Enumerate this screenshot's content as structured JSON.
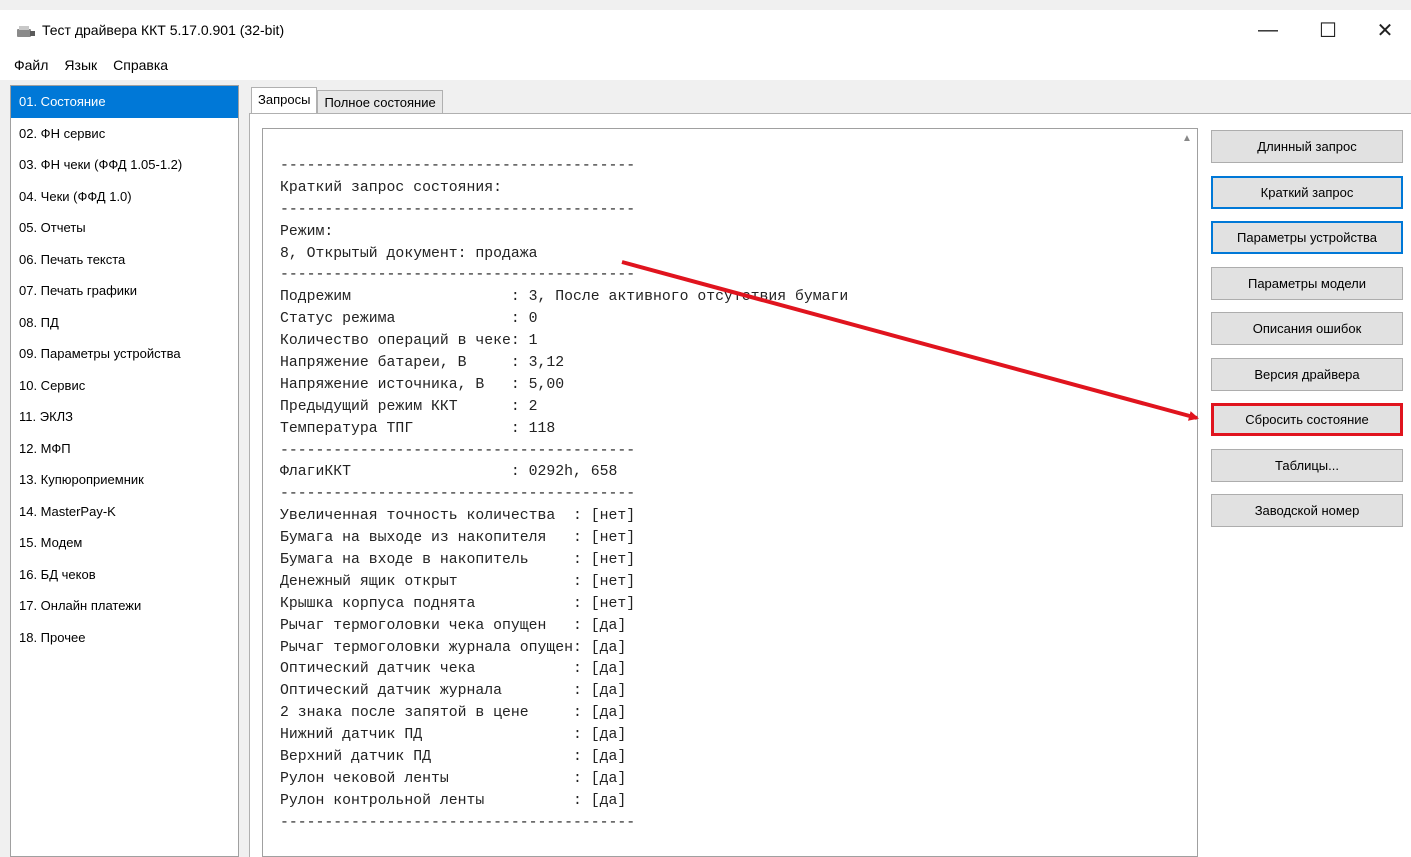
{
  "window": {
    "title": "Тест драйвера ККТ 5.17.0.901 (32-bit)",
    "min_glyph": "—",
    "max_glyph": "☐",
    "close_glyph": "✕"
  },
  "menu": {
    "items": [
      "Файл",
      "Язык",
      "Справка"
    ]
  },
  "sidebar": {
    "selected_index": 0,
    "items": [
      "01. Состояние",
      "02. ФН сервис",
      "03. ФН чеки (ФФД 1.05-1.2)",
      "04. Чеки (ФФД 1.0)",
      "05. Отчеты",
      "06. Печать текста",
      "07. Печать графики",
      "08. ПД",
      "09. Параметры устройства",
      "10. Сервис",
      "11. ЭКЛЗ",
      "12. МФП",
      "13. Купюроприемник",
      "14. MasterPay-K",
      "15. Модем",
      "16. БД чеков",
      "17. Онлайн платежи",
      "18. Прочее"
    ]
  },
  "tabs": {
    "items": [
      "Запросы",
      "Полное состояние"
    ],
    "active_index": 0
  },
  "output": {
    "lines": [
      "----------------------------------------",
      "Краткий запрос состояния:",
      "----------------------------------------",
      "Режим:",
      "8, Открытый документ: продажа",
      "----------------------------------------",
      "Подрежим                  : 3, После активного отсутствия бумаги",
      "Статус режима             : 0",
      "Количество операций в чеке: 1",
      "Напряжение батареи, В     : 3,12",
      "Напряжение источника, В   : 5,00",
      "Предыдущий режим ККТ      : 2",
      "Температура ТПГ           : 118",
      "----------------------------------------",
      "ФлагиККТ                  : 0292h, 658",
      "----------------------------------------",
      "Увеличенная точность количества  : [нет]",
      "Бумага на выходе из накопителя   : [нет]",
      "Бумага на входе в накопитель     : [нет]",
      "Денежный ящик открыт             : [нет]",
      "Крышка корпуса поднята           : [нет]",
      "Рычаг термоголовки чека опущен   : [да]",
      "Рычаг термоголовки журнала опущен: [да]",
      "Оптический датчик чека           : [да]",
      "Оптический датчик журнала        : [да]",
      "2 знака после запятой в цене     : [да]",
      "Нижний датчик ПД                 : [да]",
      "Верхний датчик ПД                : [да]",
      "Рулон чековой ленты              : [да]",
      "Рулон контрольной ленты          : [да]",
      "----------------------------------------"
    ]
  },
  "buttons": [
    {
      "label": "Длинный запрос",
      "state": "normal"
    },
    {
      "label": "Краткий запрос",
      "state": "focused"
    },
    {
      "label": "Параметры устройства",
      "state": "focused"
    },
    {
      "label": "Параметры модели",
      "state": "normal"
    },
    {
      "label": "Описания ошибок",
      "state": "normal"
    },
    {
      "label": "Версия драйвера",
      "state": "normal"
    },
    {
      "label": "Сбросить состояние",
      "state": "highlighted"
    },
    {
      "label": "Таблицы...",
      "state": "normal"
    },
    {
      "label": "Заводской номер",
      "state": "normal"
    }
  ],
  "colors": {
    "accent": "#0078d7",
    "annotation": "#e0141e"
  }
}
